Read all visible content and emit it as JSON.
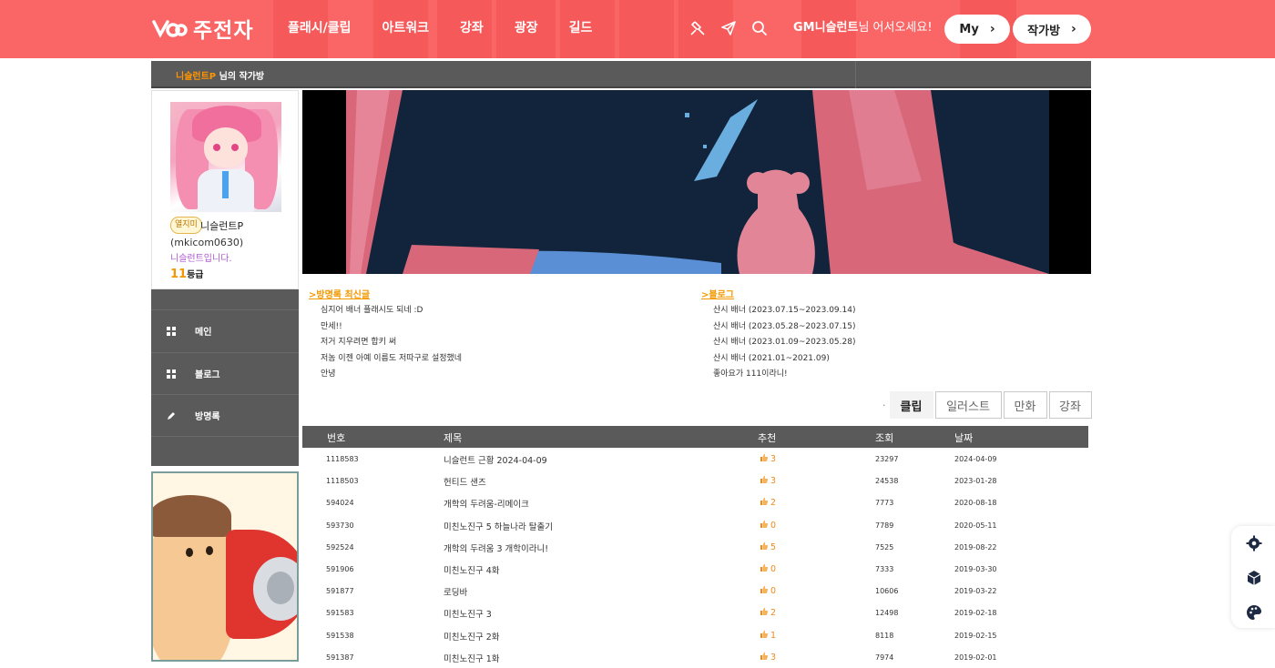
{
  "header": {
    "logo_text": "주전자",
    "nav": [
      "플래시/클립",
      "아트워크",
      "강좌",
      "광장",
      "길드"
    ],
    "icons": [
      "pin-icon",
      "send-icon",
      "search-icon"
    ],
    "greeting_name": "GM니슬런트",
    "greeting_suffix": "님 어서오세요!",
    "my_button": "My",
    "studio_button": "작가방",
    "bg_color": "#fa6565"
  },
  "title_bar": {
    "owner": "니슬런트P",
    "suffix": " 님의 작가방"
  },
  "profile": {
    "badge": "열지미",
    "name": "니슬런트P",
    "id": "(mkicom0630)",
    "desc": "니슬런트입니다.",
    "level_num": "11",
    "level_label": "등급"
  },
  "menu": [
    {
      "label": "메인",
      "icon": "grid-icon"
    },
    {
      "label": "블로그",
      "icon": "grid-icon"
    },
    {
      "label": "방명록",
      "icon": "pencil-icon"
    }
  ],
  "guestbook": {
    "title": ">방명록 최신글",
    "items": [
      "심지어 배너 플래시도 되네 :D",
      "만세!!",
      "저거 지우려면 합키 써",
      "저놈 이젠 아예 이름도 저따구로 설정했네",
      "안녕"
    ]
  },
  "blog": {
    "title": ">블로그",
    "items": [
      "산시 배너 (2023.07.15~2023.09.14)",
      "산시 배너 (2023.05.28~2023.07.15)",
      "산시 배너 (2023.01.09~2023.05.28)",
      "산시 배너 (2021.01~2021.09)",
      "좋아요가 111이라니!"
    ]
  },
  "categories": {
    "dot": "·",
    "items": [
      "클립",
      "일러스트",
      "만화",
      "강좌"
    ],
    "active": 0
  },
  "table": {
    "headers": [
      "번호",
      "제목",
      "추천",
      "조회",
      "날짜"
    ],
    "rows": [
      {
        "no": "1118583",
        "title": "니슬런트 근황 2024-04-09",
        "rec": "3",
        "views": "23297",
        "date": "2024-04-09"
      },
      {
        "no": "1118503",
        "title": "헌티드 샌즈",
        "rec": "3",
        "views": "24538",
        "date": "2023-01-28"
      },
      {
        "no": "594024",
        "title": "개학의 두려움-리메이크",
        "rec": "2",
        "views": "7773",
        "date": "2020-08-18"
      },
      {
        "no": "593730",
        "title": "미친노진구 5 하늘나라 탈출기",
        "rec": "0",
        "views": "7789",
        "date": "2020-05-11"
      },
      {
        "no": "592524",
        "title": "개학의 두려움 3 개학이라니!",
        "rec": "5",
        "views": "7525",
        "date": "2019-08-22"
      },
      {
        "no": "591906",
        "title": "미친노진구 4화",
        "rec": "0",
        "views": "7333",
        "date": "2019-03-30"
      },
      {
        "no": "591877",
        "title": "로딩바",
        "rec": "0",
        "views": "10606",
        "date": "2019-03-22"
      },
      {
        "no": "591583",
        "title": "미친노진구 3",
        "rec": "2",
        "views": "12498",
        "date": "2019-02-18"
      },
      {
        "no": "591538",
        "title": "미친노진구 2화",
        "rec": "1",
        "views": "8118",
        "date": "2019-02-15"
      },
      {
        "no": "591387",
        "title": "미친노진구 1화",
        "rec": "3",
        "views": "7974",
        "date": "2019-02-01"
      }
    ]
  },
  "float_icons": [
    "gear-icon",
    "cube-icon",
    "palette-icon"
  ]
}
